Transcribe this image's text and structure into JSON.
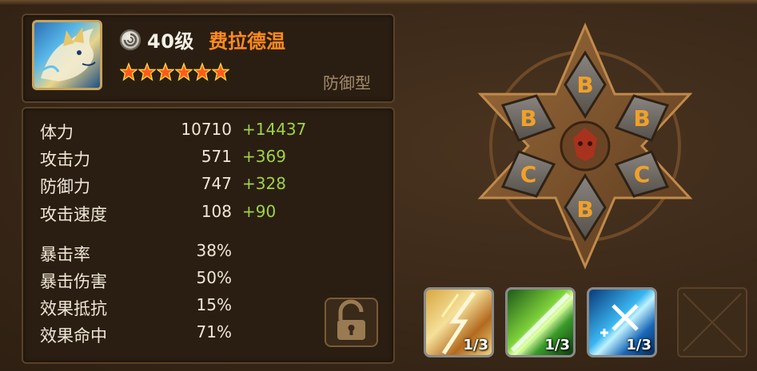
{
  "hero": {
    "level": "40级",
    "name": "费拉德温",
    "stars": 6,
    "type": "防御型",
    "element_icon": "wind-element-icon",
    "portrait_icon": "fox-beast-portrait"
  },
  "stats": [
    {
      "label": "体力",
      "value": "10710",
      "bonus": "+14437"
    },
    {
      "label": "攻击力",
      "value": "571",
      "bonus": "+369"
    },
    {
      "label": "防御力",
      "value": "747",
      "bonus": "+328"
    },
    {
      "label": "攻击速度",
      "value": "108",
      "bonus": "+90"
    },
    {
      "label": "暴击率",
      "value": "38%",
      "bonus": ""
    },
    {
      "label": "暴击伤害",
      "value": "50%",
      "bonus": ""
    },
    {
      "label": "效果抵抗",
      "value": "15%",
      "bonus": ""
    },
    {
      "label": "效果命中",
      "value": "71%",
      "bonus": ""
    }
  ],
  "runes": {
    "slots": [
      {
        "slot": 1,
        "glyph": "B"
      },
      {
        "slot": 2,
        "glyph": "B"
      },
      {
        "slot": 3,
        "glyph": "C"
      },
      {
        "slot": 4,
        "glyph": "B"
      },
      {
        "slot": 5,
        "glyph": "C"
      },
      {
        "slot": 6,
        "glyph": "B"
      }
    ]
  },
  "skills": [
    {
      "name": "skill-1",
      "level": "1/3"
    },
    {
      "name": "skill-2",
      "level": "1/3"
    },
    {
      "name": "skill-3",
      "level": "1/3"
    }
  ],
  "colors": {
    "name": "#ff8a1e",
    "bonus": "#9ed24a",
    "panel": "#2a1e12"
  }
}
